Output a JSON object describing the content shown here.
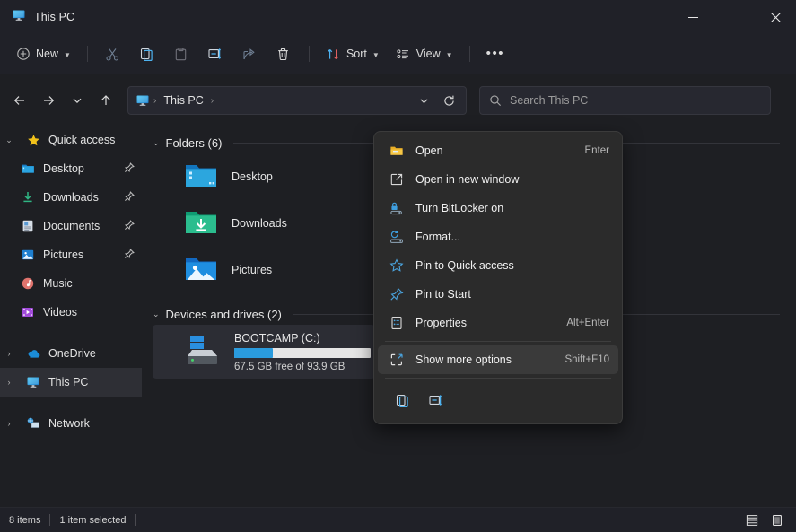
{
  "window": {
    "title": "This PC",
    "icon": "this-pc-monitor-icon",
    "controls": {
      "minimize": "–",
      "maximize": "☐",
      "close": "✕"
    }
  },
  "toolbar": {
    "new_label": "New",
    "sort_label": "Sort",
    "view_label": "View",
    "more_label": "•••",
    "buttons": [
      {
        "name": "cut",
        "icon": "scissors-icon"
      },
      {
        "name": "copy",
        "icon": "copy-icon"
      },
      {
        "name": "paste",
        "icon": "paste-icon"
      },
      {
        "name": "rename",
        "icon": "rename-icon"
      },
      {
        "name": "share",
        "icon": "share-icon"
      },
      {
        "name": "delete",
        "icon": "trash-icon"
      }
    ]
  },
  "address": {
    "back": "back-arrow-icon",
    "forward": "forward-arrow-icon",
    "recent": "chevron-down-icon",
    "up": "up-arrow-icon",
    "crumb_root_icon": "this-pc-monitor-icon",
    "crumb_sep_1": "›",
    "crumb_label": "This PC",
    "crumb_sep_2": "›",
    "dropdown": "chevron-down-icon",
    "refresh": "refresh-icon"
  },
  "search": {
    "icon": "search-icon",
    "placeholder": "Search This PC"
  },
  "sidebar": {
    "items": [
      {
        "label": "Quick access",
        "icon": "star-icon",
        "arrow": "⌄",
        "indent": false,
        "pinned": false,
        "selected": false
      },
      {
        "label": "Desktop",
        "icon": "desktop-folder-icon",
        "arrow": "",
        "indent": true,
        "pinned": true,
        "selected": false
      },
      {
        "label": "Downloads",
        "icon": "downloads-folder-icon",
        "arrow": "",
        "indent": true,
        "pinned": true,
        "selected": false
      },
      {
        "label": "Documents",
        "icon": "documents-folder-icon",
        "arrow": "",
        "indent": true,
        "pinned": true,
        "selected": false
      },
      {
        "label": "Pictures",
        "icon": "pictures-folder-icon",
        "arrow": "",
        "indent": true,
        "pinned": true,
        "selected": false
      },
      {
        "label": "Music",
        "icon": "music-folder-icon",
        "arrow": "",
        "indent": true,
        "pinned": false,
        "selected": false
      },
      {
        "label": "Videos",
        "icon": "videos-folder-icon",
        "arrow": "",
        "indent": true,
        "pinned": false,
        "selected": false
      },
      {
        "label": "OneDrive",
        "icon": "onedrive-cloud-icon",
        "arrow": "›",
        "indent": false,
        "pinned": false,
        "selected": false
      },
      {
        "label": "This PC",
        "icon": "this-pc-monitor-icon",
        "arrow": "›",
        "indent": false,
        "pinned": false,
        "selected": true
      },
      {
        "label": "Network",
        "icon": "network-icon",
        "arrow": "›",
        "indent": false,
        "pinned": false,
        "selected": false
      }
    ]
  },
  "content": {
    "folders_group": {
      "title": "Folders (6)",
      "arrow": "⌄",
      "items": [
        {
          "label": "Desktop",
          "icon": "desktop-folder-icon"
        },
        {
          "label": "Downloads",
          "icon": "downloads-folder-icon"
        },
        {
          "label": "Pictures",
          "icon": "pictures-folder-icon"
        }
      ]
    },
    "drives_group": {
      "title": "Devices and drives (2)",
      "arrow": "⌄",
      "items": [
        {
          "label": "BOOTCAMP (C:)",
          "icon": "windows-drive-icon",
          "free_text": "67.5 GB free of 93.9 GB",
          "used_percent": 28,
          "bar_color": "#2a9bdd",
          "selected": true
        }
      ]
    }
  },
  "context_menu": {
    "items": [
      {
        "label": "Open",
        "icon": "folder-open-icon",
        "accel": "Enter",
        "hover": false
      },
      {
        "label": "Open in new window",
        "icon": "open-new-window-icon",
        "accel": "",
        "hover": false
      },
      {
        "label": "Turn BitLocker on",
        "icon": "bitlocker-lock-icon",
        "accel": "",
        "hover": false
      },
      {
        "label": "Format...",
        "icon": "format-drive-icon",
        "accel": "",
        "hover": false
      },
      {
        "label": "Pin to Quick access",
        "icon": "star-outline-icon",
        "accel": "",
        "hover": false
      },
      {
        "label": "Pin to Start",
        "icon": "pin-icon",
        "accel": "",
        "hover": false
      },
      {
        "label": "Properties",
        "icon": "properties-icon",
        "accel": "Alt+Enter",
        "hover": false
      },
      {
        "label": "Show more options",
        "icon": "show-more-options-icon",
        "accel": "Shift+F10",
        "hover": true
      }
    ],
    "icon_row": [
      {
        "name": "copy",
        "icon": "copy-icon"
      },
      {
        "name": "rename",
        "icon": "rename-icon"
      }
    ]
  },
  "status": {
    "items_count": "8 items",
    "selection": "1 item selected",
    "view_details_icon": "details-view-icon",
    "view_tiles_icon": "tiles-view-icon"
  },
  "colors": {
    "accent": "#2a9bdd",
    "window_bg": "#1e1f23",
    "chrome_bg": "#202128",
    "menu_bg": "#2b2b2b",
    "selection": "#2e2f35",
    "icon_blue": "#4db2f0"
  }
}
